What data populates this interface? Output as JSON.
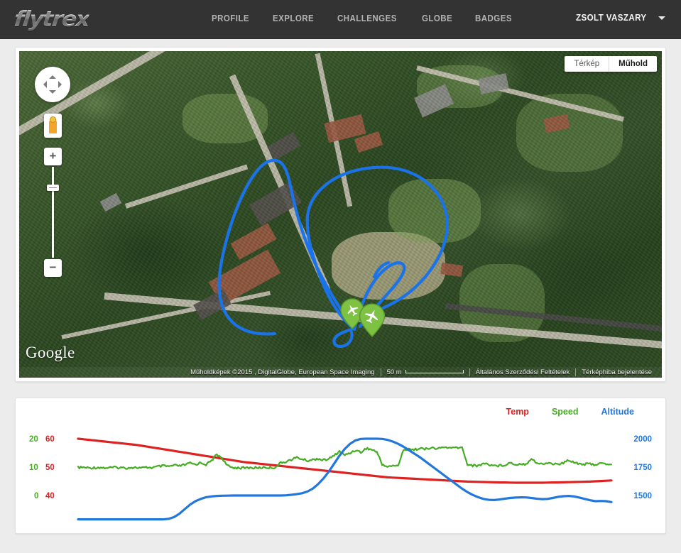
{
  "header": {
    "logo_text": "flytrex",
    "nav": [
      {
        "label": "PROFILE"
      },
      {
        "label": "EXPLORE"
      },
      {
        "label": "CHALLENGES"
      },
      {
        "label": "GLOBE"
      },
      {
        "label": "BADGES"
      }
    ],
    "user_name": "ZSOLT VASZARY",
    "caret_icon": "chevron-down-icon",
    "bg_color": "#333333"
  },
  "map": {
    "provider_logo": "Google",
    "map_type_buttons": [
      {
        "label": "Térkép",
        "active": false
      },
      {
        "label": "Műhold",
        "active": true
      }
    ],
    "controls": {
      "pan_icon": "pan-control-icon",
      "pegman_icon": "street-view-pegman-icon",
      "zoom_in_label": "+",
      "zoom_out_label": "−"
    },
    "attribution": {
      "imagery": "Műholdképek ©2015 , DigitalGlobe, European Space Imaging",
      "scale_label": "50 m",
      "terms": "Általános Szerződési Feltételek",
      "report": "Térképhiba bejelentése"
    },
    "markers": [
      {
        "icon": "airplane-pin-icon",
        "color": "#7dc243"
      },
      {
        "icon": "airplane-pin-icon",
        "color": "#7dc243"
      }
    ],
    "track_color": "#1a73e8"
  },
  "chart_colors": {
    "temp": "#dd2222",
    "speed": "#45ad23",
    "altitude": "#2277dd"
  },
  "chart_data": {
    "type": "line",
    "title": "",
    "xlabel": "",
    "grid": false,
    "legend_position": "top-right",
    "x": [
      0,
      1,
      2,
      3,
      4,
      5,
      6,
      7,
      8,
      9,
      10,
      11,
      12,
      13,
      14,
      15,
      16,
      17,
      18,
      19,
      20,
      21,
      22,
      23,
      24,
      25,
      26,
      27,
      28,
      29,
      30,
      31,
      32,
      33,
      34,
      35,
      36,
      37,
      38,
      39,
      40,
      41,
      42,
      43,
      44,
      45,
      46,
      47,
      48,
      49,
      50,
      51,
      52,
      53,
      54,
      55,
      56,
      57,
      58,
      59,
      60,
      61,
      62,
      63,
      64,
      65,
      66,
      67,
      68,
      69,
      70,
      71,
      72,
      73,
      74,
      75,
      76,
      77,
      78,
      79,
      80,
      81,
      82,
      83,
      84,
      85,
      86,
      87,
      88,
      89,
      90,
      91,
      92,
      93,
      94,
      95,
      96,
      97,
      98,
      99,
      100
    ],
    "axes": [
      {
        "id": "speed",
        "side": "left",
        "label": "Speed",
        "color": "#45ad23",
        "ticks": [
          20,
          10,
          0
        ],
        "ylim": [
          0,
          20
        ]
      },
      {
        "id": "temp",
        "side": "left",
        "label": "Temp",
        "color": "#dd2222",
        "ticks": [
          60,
          50,
          40
        ],
        "ylim": [
          40,
          60
        ]
      },
      {
        "id": "altitude",
        "side": "right",
        "label": "Altitude",
        "color": "#2277dd",
        "ticks": [
          2000,
          1750,
          1500
        ],
        "ylim": [
          1250,
          2000
        ]
      }
    ],
    "series": [
      {
        "name": "Temp",
        "axis": "temp",
        "color": "#dd2222",
        "values": [
          60.0,
          59.8,
          59.6,
          59.4,
          59.2,
          59.0,
          58.8,
          58.6,
          58.4,
          58.2,
          58.0,
          57.8,
          57.5,
          57.2,
          56.9,
          56.6,
          56.3,
          56.0,
          55.7,
          55.4,
          55.1,
          54.8,
          54.5,
          54.2,
          53.9,
          53.6,
          53.3,
          53.0,
          52.7,
          52.4,
          52.1,
          51.8,
          51.6,
          51.4,
          51.2,
          51.0,
          50.8,
          50.6,
          50.4,
          50.2,
          50.0,
          49.8,
          49.6,
          49.4,
          49.2,
          49.0,
          48.8,
          48.6,
          48.4,
          48.2,
          48.0,
          47.8,
          47.6,
          47.4,
          47.2,
          47.0,
          46.8,
          46.6,
          46.4,
          46.3,
          46.2,
          46.1,
          46.0,
          45.9,
          45.8,
          45.7,
          45.6,
          45.5,
          45.4,
          45.3,
          45.2,
          45.1,
          45.0,
          44.9,
          44.85,
          44.8,
          44.75,
          44.7,
          44.65,
          44.6,
          44.6,
          44.55,
          44.5,
          44.5,
          44.5,
          44.5,
          44.5,
          44.5,
          44.55,
          44.6,
          44.6,
          44.65,
          44.7,
          44.75,
          44.8,
          44.85,
          44.9,
          45.0,
          45.1,
          45.2,
          45.3
        ]
      },
      {
        "name": "Speed",
        "axis": "speed",
        "color": "#45ad23",
        "values": [
          9.8,
          9.9,
          9.7,
          9.8,
          9.9,
          9.7,
          9.8,
          9.9,
          9.8,
          9.7,
          9.9,
          9.8,
          9.7,
          9.9,
          9.8,
          10.2,
          10.4,
          10.2,
          10.6,
          10.4,
          10.8,
          11.4,
          10.9,
          11.6,
          10.9,
          12.2,
          14.5,
          13.2,
          10.4,
          9.8,
          9.8,
          9.7,
          9.8,
          9.7,
          9.8,
          9.9,
          9.8,
          9.9,
          11.5,
          12.0,
          12.6,
          13.4,
          12.8,
          12.3,
          12.6,
          13.0,
          12.4,
          12.9,
          14.0,
          15.6,
          14.2,
          15.0,
          16.0,
          15.2,
          16.6,
          16.2,
          15.4,
          11.0,
          10.2,
          10.4,
          10.6,
          15.8,
          16.6,
          16.0,
          16.8,
          16.2,
          16.9,
          16.4,
          16.8,
          17.0,
          16.6,
          16.9,
          16.8,
          11.0,
          10.6,
          10.4,
          11.4,
          10.9,
          10.6,
          10.5,
          10.8,
          11.6,
          10.9,
          11.2,
          11.0,
          13.2,
          11.4,
          11.0,
          11.5,
          11.2,
          11.0,
          11.4,
          12.5,
          11.8,
          11.2,
          11.0,
          11.1,
          10.9,
          11.3,
          11.0,
          11.2
        ]
      },
      {
        "name": "Altitude",
        "axis": "altitude",
        "color": "#2277dd",
        "values": [
          1290,
          1290,
          1290,
          1290,
          1290,
          1290,
          1290,
          1290,
          1290,
          1290,
          1290,
          1290,
          1290,
          1290,
          1290,
          1290,
          1290,
          1295,
          1310,
          1340,
          1380,
          1420,
          1450,
          1470,
          1485,
          1492,
          1496,
          1498,
          1499,
          1500,
          1500,
          1500,
          1500,
          1500,
          1500,
          1500,
          1500,
          1500,
          1500,
          1502,
          1506,
          1512,
          1520,
          1535,
          1560,
          1600,
          1650,
          1710,
          1780,
          1850,
          1910,
          1955,
          1985,
          1998,
          2000,
          2000,
          2000,
          1998,
          1990,
          1975,
          1955,
          1930,
          1900,
          1870,
          1840,
          1805,
          1770,
          1735,
          1700,
          1665,
          1630,
          1595,
          1560,
          1530,
          1505,
          1485,
          1470,
          1462,
          1460,
          1465,
          1472,
          1478,
          1482,
          1484,
          1483,
          1478,
          1472,
          1468,
          1470,
          1478,
          1488,
          1494,
          1496,
          1492,
          1482,
          1470,
          1458,
          1450,
          1452,
          1450,
          1442
        ]
      }
    ]
  }
}
